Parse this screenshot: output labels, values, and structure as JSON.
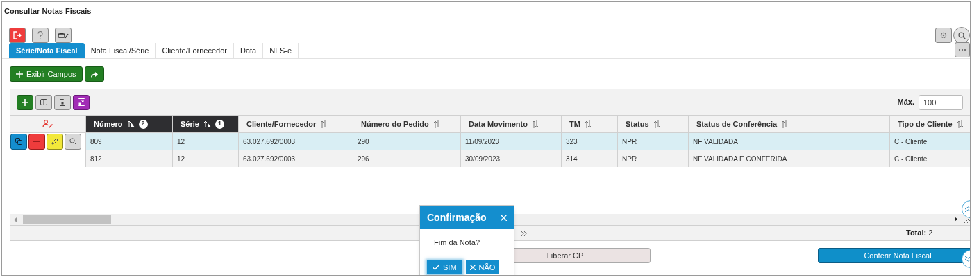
{
  "window": {
    "title": "Consultar Notas Fiscais"
  },
  "tabs": [
    {
      "label": "Série/Nota Fiscal",
      "selected": true
    },
    {
      "label": "Nota Fiscal/Série",
      "selected": false
    },
    {
      "label": "Cliente/Fornecedor",
      "selected": false
    },
    {
      "label": "Data",
      "selected": false
    },
    {
      "label": "NFS-e",
      "selected": false
    }
  ],
  "show_fields_button": "Exibir Campos",
  "max_label": "Máx.",
  "max_value": "100",
  "table": {
    "columns": [
      {
        "label": "Número",
        "sorted": true,
        "rank": "2"
      },
      {
        "label": "Série",
        "sorted": true,
        "rank": "1"
      },
      {
        "label": "Cliente/Fornecedor",
        "sorted": false
      },
      {
        "label": "Número do Pedido",
        "sorted": false
      },
      {
        "label": "Data Movimento",
        "sorted": false
      },
      {
        "label": "TM",
        "sorted": false
      },
      {
        "label": "Status",
        "sorted": false
      },
      {
        "label": "Status de Conferência",
        "sorted": false
      },
      {
        "label": "Tipo de Cliente",
        "sorted": false
      }
    ],
    "rows": [
      {
        "selected": true,
        "cells": [
          "809",
          "12",
          "63.027.692/0003",
          "290",
          "11/09/2023",
          "323",
          "NPR",
          "NF VALIDADA",
          "C - Cliente"
        ]
      },
      {
        "selected": false,
        "cells": [
          "812",
          "12",
          "63.027.692/0003",
          "296",
          "30/09/2023",
          "314",
          "NPR",
          "NF VALIDADA E CONFERIDA",
          "C - Cliente"
        ]
      }
    ]
  },
  "total": "**Total:** 2",
  "buttons": [
    "Liberar CP",
    "Conferir Nota Fiscal"
  ],
  "dialog": {
    "title": "Confirmação",
    "message": "Fim da Nota?",
    "confirm": "SIM",
    "cancel": "NÃO"
  }
}
